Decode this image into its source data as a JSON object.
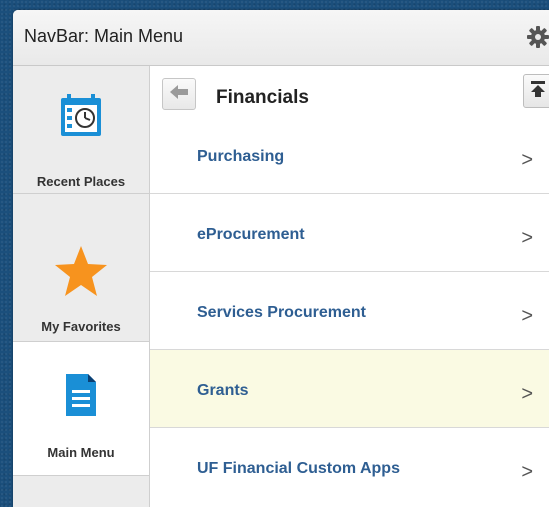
{
  "header": {
    "title": "NavBar: Main Menu",
    "settings_icon": "gear-icon"
  },
  "sidebar": {
    "items": [
      {
        "label": "Recent Places",
        "icon": "calendar-clock-icon",
        "active": false
      },
      {
        "label": "My Favorites",
        "icon": "star-icon",
        "active": false
      },
      {
        "label": "Main Menu",
        "icon": "document-icon",
        "active": true
      }
    ]
  },
  "main": {
    "title": "Financials",
    "back_icon": "arrow-left-icon",
    "top_icon": "scroll-to-top-icon",
    "items": [
      {
        "label": "Purchasing"
      },
      {
        "label": "eProcurement"
      },
      {
        "label": "Services Procurement"
      },
      {
        "label": "Grants"
      },
      {
        "label": "UF Financial Custom Apps"
      }
    ],
    "chevron": ">"
  },
  "colors": {
    "link": "#2e5e92",
    "highlight_row": "#fafae3",
    "star": "#f7931e",
    "calendar": "#1a8fd6",
    "document": "#1a8fd6",
    "background": "#1b4f7c"
  }
}
